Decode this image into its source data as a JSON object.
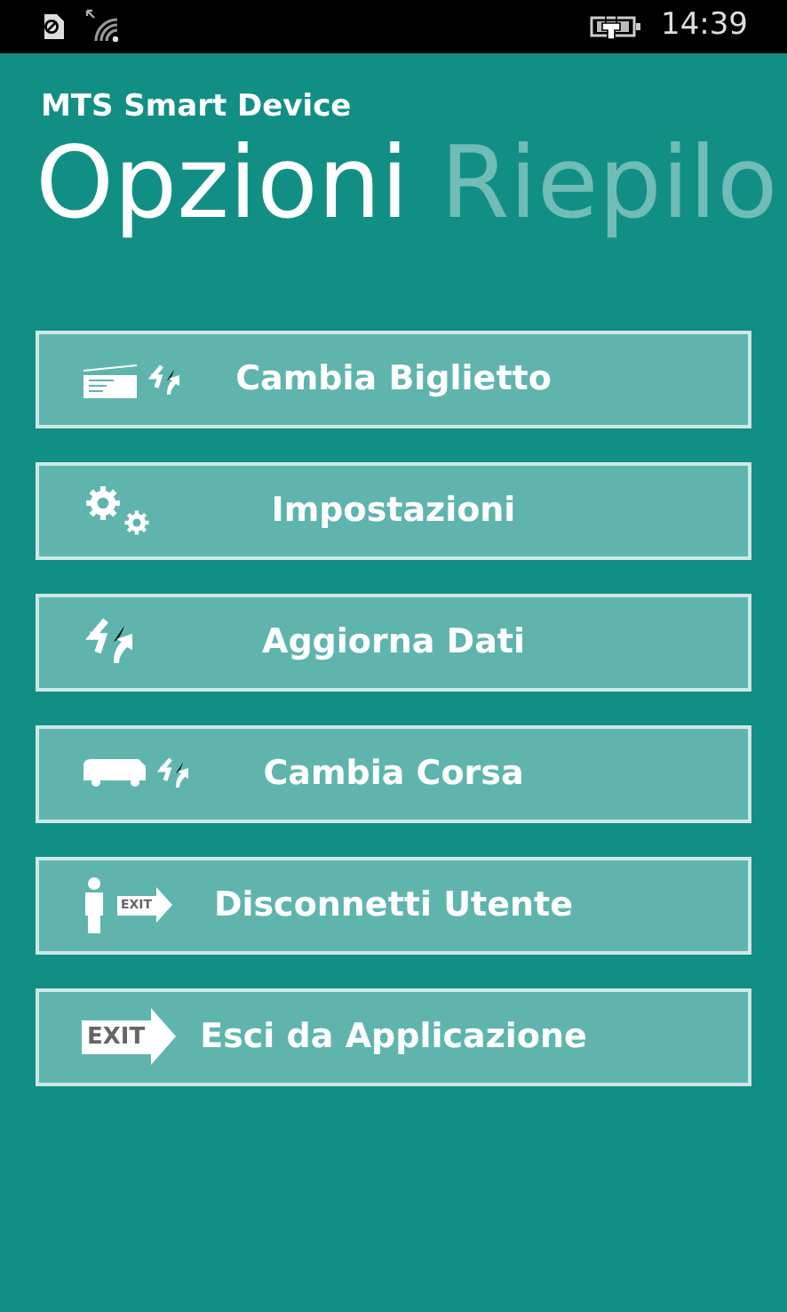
{
  "status_bar": {
    "time": "14:39"
  },
  "app_title": "MTS Smart Device",
  "pivot": [
    {
      "label": "Opzioni",
      "selected": true
    },
    {
      "label": "Riepilo",
      "selected": false
    }
  ],
  "buttons": [
    {
      "label": "Cambia Biglietto",
      "kind": "ticket"
    },
    {
      "label": "Impostazioni",
      "kind": "settings"
    },
    {
      "label": "Aggiorna Dati",
      "kind": "refresh"
    },
    {
      "label": "Cambia Corsa",
      "kind": "bus"
    },
    {
      "label": "Disconnetti Utente",
      "kind": "logout",
      "sign": "EXIT"
    },
    {
      "label": "Esci da Applicazione",
      "kind": "exit",
      "sign": "EXIT"
    }
  ]
}
